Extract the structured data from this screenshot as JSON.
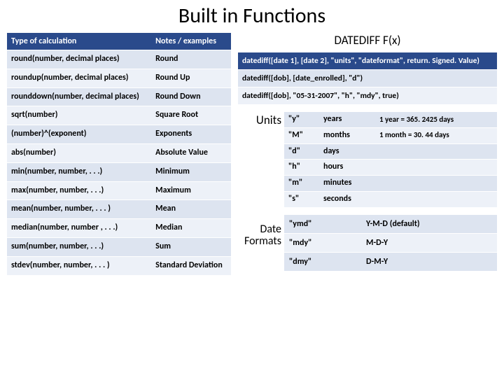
{
  "title": "Built in Functions",
  "right_title": "DATEDIFF  F(x)",
  "left_table": {
    "headers": [
      "Type of calculation",
      "Notes / examples"
    ],
    "rows": [
      {
        "c0": "round(number, decimal places)",
        "c1": "Round"
      },
      {
        "c0": "roundup(number, decimal places)",
        "c1": "Round Up"
      },
      {
        "c0": "rounddown(number, decimal places)",
        "c1": "Round Down"
      },
      {
        "c0": "sqrt(number)",
        "c1": "Square Root"
      },
      {
        "c0": "(number)^(exponent)",
        "c1": "Exponents"
      },
      {
        "c0": "abs(number)",
        "c1": "Absolute Value"
      },
      {
        "c0": "min(number, number, . . .)",
        "c1": "Minimum"
      },
      {
        "c0": "max(number, number, . . .)",
        "c1": "Maximum"
      },
      {
        "c0": "mean(number, number, . . . )",
        "c1": "Mean"
      },
      {
        "c0": "median(number, number , . . .)",
        "c1": "Median"
      },
      {
        "c0": "sum(number, number, . . .)",
        "c1": "Sum"
      },
      {
        "c0": "stdev(number, number, . . . )",
        "c1": "Standard Deviation"
      }
    ]
  },
  "datediff_rows": [
    "datediff([date 1], [date 2], \"units\", \"dateformat\", return. Signed. Value)",
    "datediff([dob], [date_enrolled], \"d\")",
    "datediff([dob], \"05-31-2007\", \"h\", \"mdy\", true)"
  ],
  "units_label": "Units",
  "units_rows": [
    {
      "code": "\"y\"",
      "name": "years",
      "note": "1 year = 365. 2425 days"
    },
    {
      "code": "\"M\"",
      "name": "months",
      "note": "1 month = 30. 44 days"
    },
    {
      "code": "\"d\"",
      "name": "days",
      "note": ""
    },
    {
      "code": "\"h\"",
      "name": "hours",
      "note": ""
    },
    {
      "code": "\"m\"",
      "name": "minutes",
      "note": ""
    },
    {
      "code": "\"s\"",
      "name": "seconds",
      "note": ""
    }
  ],
  "dateformats_label": "Date Formats",
  "dateformats_rows": [
    {
      "code": "\"ymd\"",
      "name": "Y-M-D (default)"
    },
    {
      "code": "\"mdy\"",
      "name": "M-D-Y"
    },
    {
      "code": "\"dmy\"",
      "name": "D-M-Y"
    }
  ]
}
